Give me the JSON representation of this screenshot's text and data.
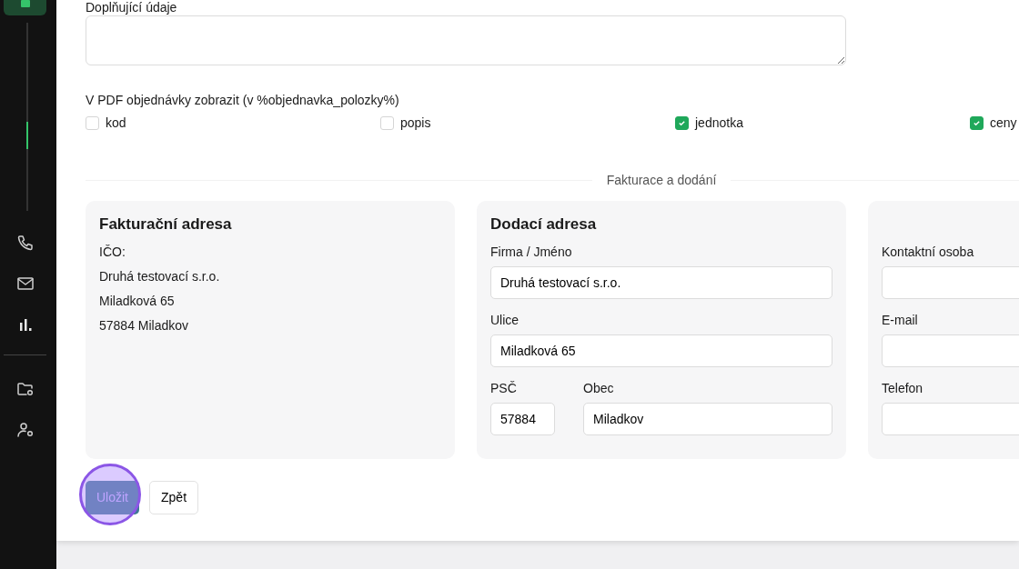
{
  "sidebar": {
    "items": [
      {
        "selected": false
      },
      {
        "selected": false
      },
      {
        "selected": false
      },
      {
        "selected": false
      },
      {
        "selected": false
      }
    ],
    "progress": {
      "level": 0.6
    }
  },
  "notes": {
    "label": "Doplňující údaje"
  },
  "pdf_options": {
    "label": "V PDF objednávky zobrazit (v %objednavka_polozky%)",
    "options": [
      {
        "label": "kod",
        "checked": false
      },
      {
        "label": "popis",
        "checked": false
      },
      {
        "label": "jednotka",
        "checked": true
      },
      {
        "label": "ceny",
        "checked": true
      }
    ]
  },
  "section_divider": "Fakturace a dodání",
  "billing": {
    "title": "Fakturační adresa",
    "lines": [
      "IČO:",
      "Druhá testovací s.r.o.",
      "Miladková 65",
      "57884 Miladkov"
    ]
  },
  "delivery": {
    "title": "Dodací adresa",
    "fields": [
      {
        "label": "Firma / Jméno",
        "value": "Druhá testovací s.r.o."
      },
      {
        "label": "Ulice",
        "value": "Miladková 65"
      },
      {
        "label": "PSČ",
        "value": "57884"
      },
      {
        "label": "Obec",
        "value": "Miladkov"
      }
    ]
  },
  "contact": {
    "fields": [
      {
        "label": "Kontaktní osoba"
      },
      {
        "label": "E-mail"
      },
      {
        "label": "Telefon"
      }
    ]
  },
  "buttons": [
    {
      "label": "Uložit",
      "kind": "primary",
      "highlighted": true
    },
    {
      "label": "Zpět",
      "kind": "secondary",
      "highlighted": false
    }
  ]
}
